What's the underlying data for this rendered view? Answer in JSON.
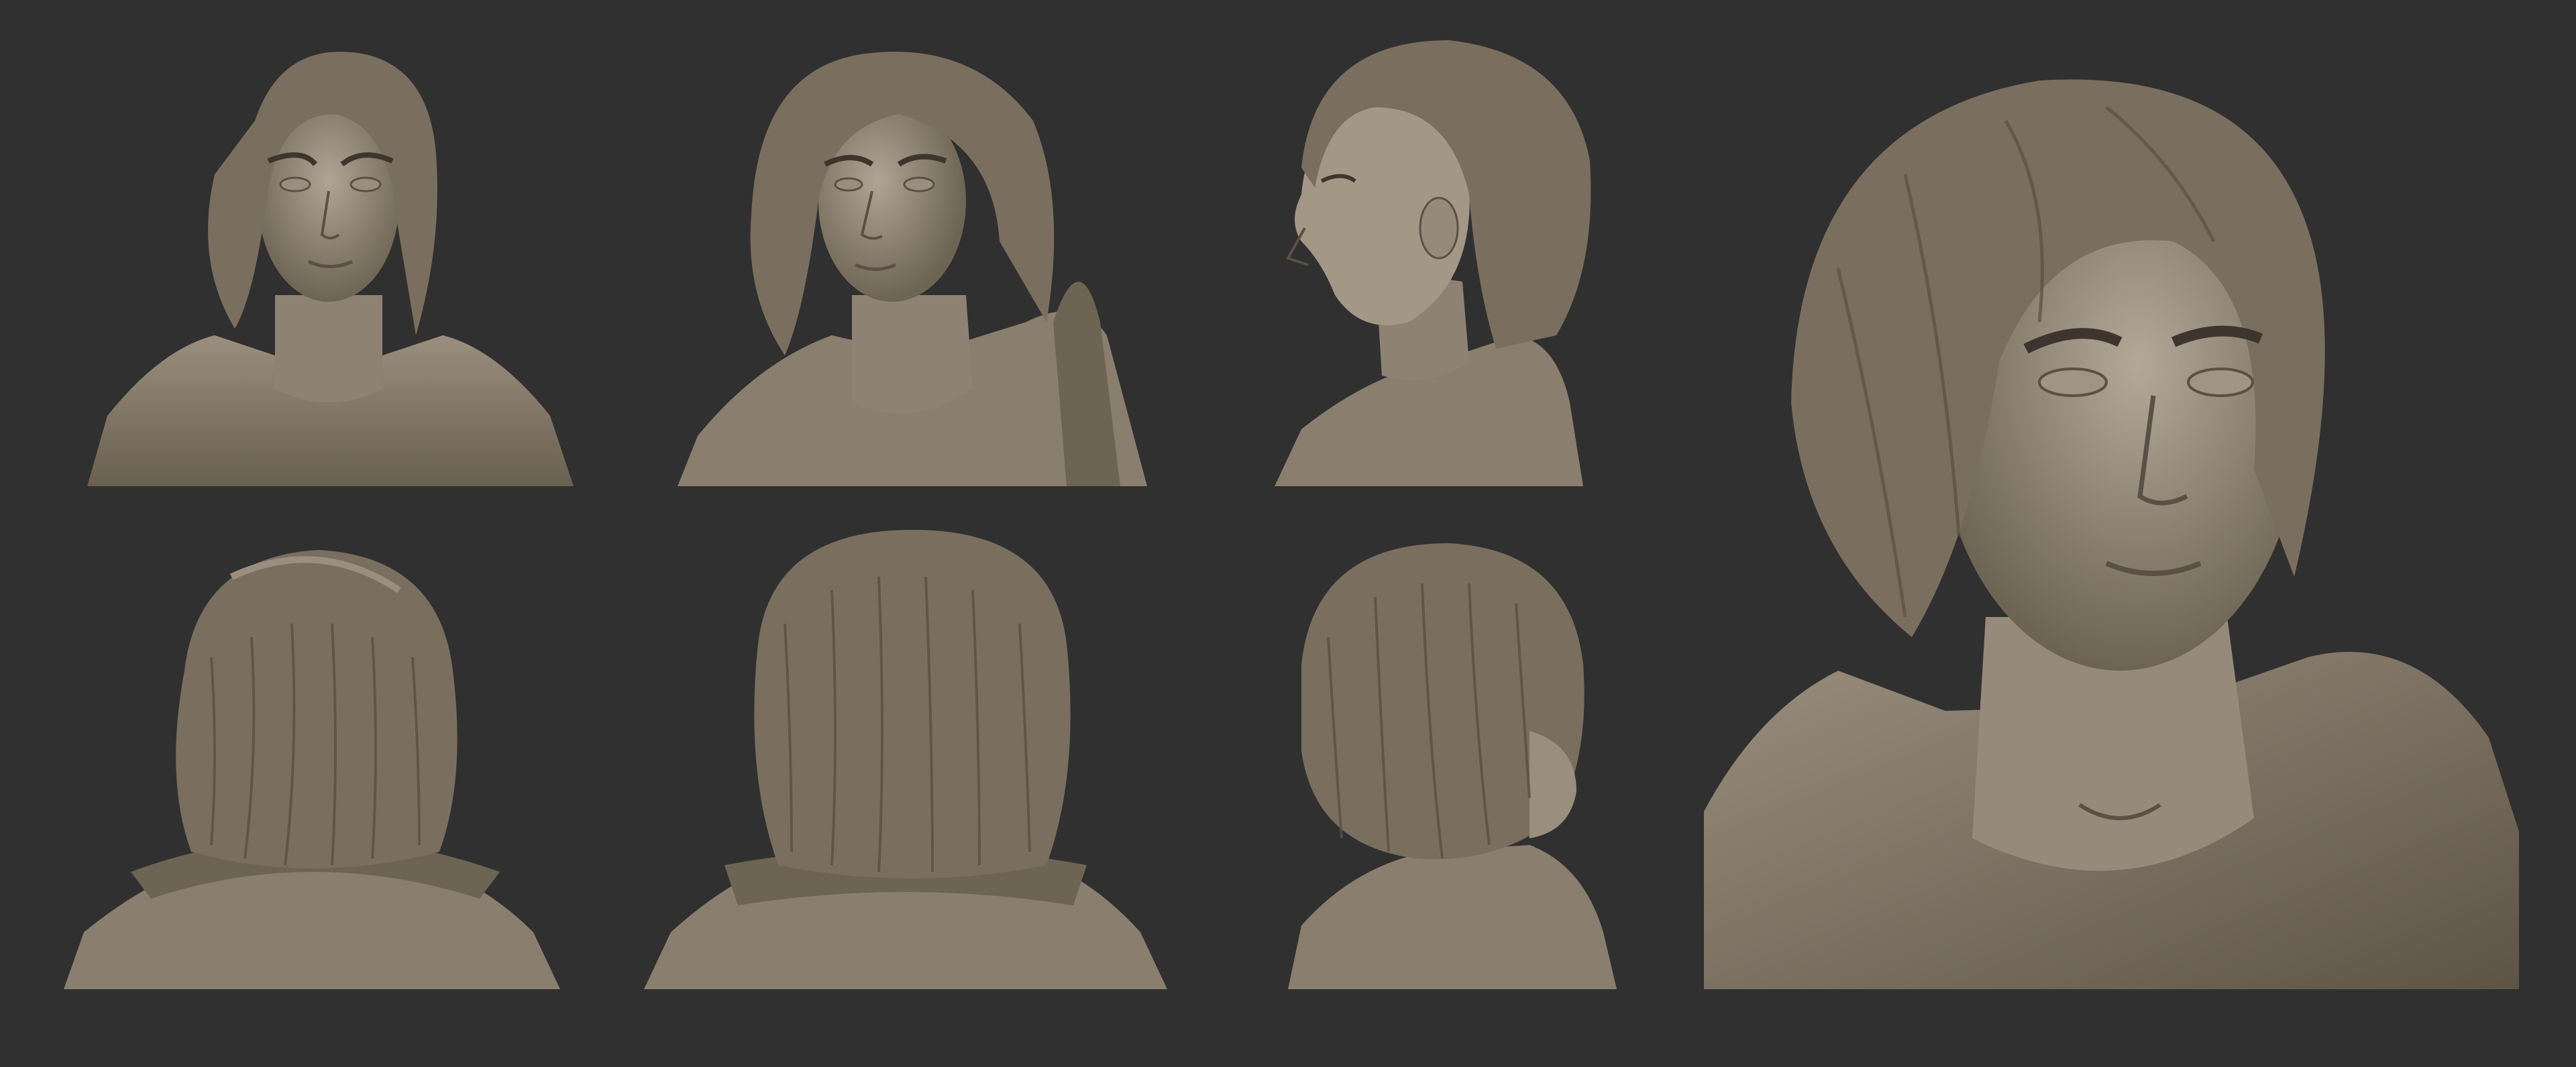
{
  "palette": {
    "background": "#303030",
    "clay_light": "#a89c8c",
    "clay_mid": "#8a7e6e",
    "clay_dark": "#5a5044",
    "clay_shadow": "#3e362e"
  },
  "views": [
    {
      "id": "front",
      "kind": "face"
    },
    {
      "id": "three-quarter-left",
      "kind": "face"
    },
    {
      "id": "profile-left",
      "kind": "face"
    },
    {
      "id": "back",
      "kind": "back"
    },
    {
      "id": "back-low",
      "kind": "back"
    },
    {
      "id": "back-three-quarter",
      "kind": "back"
    },
    {
      "id": "closeup-three-quarter",
      "kind": "face"
    }
  ]
}
